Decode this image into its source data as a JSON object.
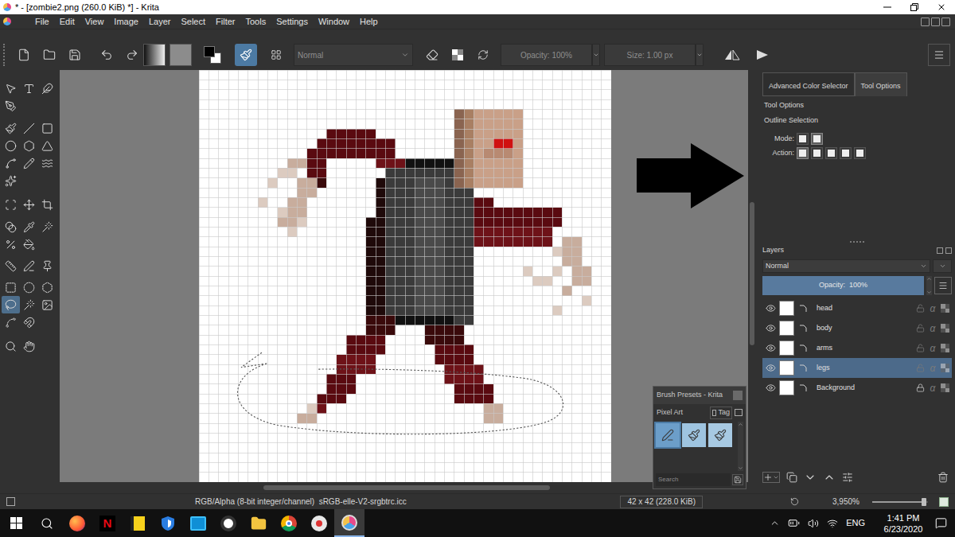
{
  "window": {
    "title": "* - [zombie2.png (260.0 KiB) *] - Krita"
  },
  "menu": [
    "File",
    "Edit",
    "View",
    "Image",
    "Layer",
    "Select",
    "Filter",
    "Tools",
    "Settings",
    "Window",
    "Help"
  ],
  "toolbar": {
    "blend_mode": "Normal",
    "opacity": "Opacity: 100%",
    "size": "Size: 1.00 px"
  },
  "toolbox": {
    "tools": [
      {
        "selected": false
      },
      {
        "selected": false
      },
      {
        "selected": false
      },
      {
        "selected": false
      },
      {
        "selected": false
      },
      {
        "selected": false
      },
      {
        "selected": false
      },
      {
        "selected": false
      },
      {
        "selected": false
      },
      {
        "selected": false
      },
      {
        "selected": false
      },
      {
        "selected": false
      },
      {
        "selected": false
      },
      {
        "selected": false
      },
      {
        "selected": false
      },
      {
        "selected": false
      },
      {
        "selected": false
      },
      {
        "selected": false
      },
      {
        "selected": false
      },
      {
        "selected": false
      },
      {
        "selected": false
      },
      {
        "selected": false
      },
      {
        "selected": false
      },
      {
        "selected": false
      },
      {
        "selected": false
      },
      {
        "selected": false
      },
      {
        "selected": false
      },
      {
        "selected": false
      },
      {
        "selected": true
      },
      {
        "selected": false
      },
      {
        "selected": false
      },
      {
        "selected": false
      },
      {
        "selected": false
      },
      {
        "selected": false
      },
      {
        "selected": false
      }
    ]
  },
  "docker_tabs": [
    {
      "label": "Advanced Color Selector",
      "selected": false
    },
    {
      "label": "Tool Options",
      "selected": true
    }
  ],
  "tool_options": {
    "title": "Tool Options",
    "section": "Outline Selection",
    "mode_label": "Mode:",
    "mode_buttons": [
      {
        "selected": false
      },
      {
        "selected": true
      }
    ],
    "action_label": "Action:",
    "action_buttons": [
      {
        "selected": true
      },
      {
        "selected": false
      },
      {
        "selected": false
      },
      {
        "selected": false
      },
      {
        "selected": false
      }
    ]
  },
  "layers": {
    "title": "Layers",
    "blend_mode": "Normal",
    "opacity": "Opacity:  100%",
    "opacity_level": 1,
    "alpha_glyph": "α",
    "items": [
      {
        "name": "head",
        "visible": true,
        "selected": false,
        "locked": false
      },
      {
        "name": "body",
        "visible": true,
        "selected": false,
        "locked": false
      },
      {
        "name": "arms",
        "visible": true,
        "selected": false,
        "locked": false
      },
      {
        "name": "legs",
        "visible": true,
        "selected": true,
        "locked": false
      },
      {
        "name": "Background",
        "visible": true,
        "selected": false,
        "locked": true
      }
    ]
  },
  "brush_presets": {
    "title": "Brush Presets - Krita",
    "tag_group": "Pixel Art",
    "tag_button": "Tag",
    "search_placeholder": "Search",
    "presets": [
      {
        "selected": true
      },
      {
        "selected": false
      },
      {
        "selected": false
      }
    ]
  },
  "status_bar": {
    "color_space": "RGB/Alpha (8-bit integer/channel)  sRGB-elle-V2-srgbtrc.icc",
    "image_size": "42 x 42 (228.0 KiB)",
    "zoom": "3,950%",
    "zoom_level": 0.88
  },
  "taskbar": {
    "apps": [
      {
        "kind": "firefox",
        "active": false
      },
      {
        "kind": "netflix",
        "active": false,
        "glyph": "N"
      },
      {
        "kind": "notes",
        "active": false
      },
      {
        "kind": "shield",
        "active": false
      },
      {
        "kind": "store",
        "active": false
      },
      {
        "kind": "github",
        "active": false
      },
      {
        "kind": "folder",
        "active": false
      },
      {
        "kind": "chrome",
        "active": false
      },
      {
        "kind": "paint",
        "active": false
      },
      {
        "kind": "krita",
        "active": true
      }
    ],
    "language": "ENG",
    "time": "1:41 PM",
    "date": "6/23/2020"
  }
}
